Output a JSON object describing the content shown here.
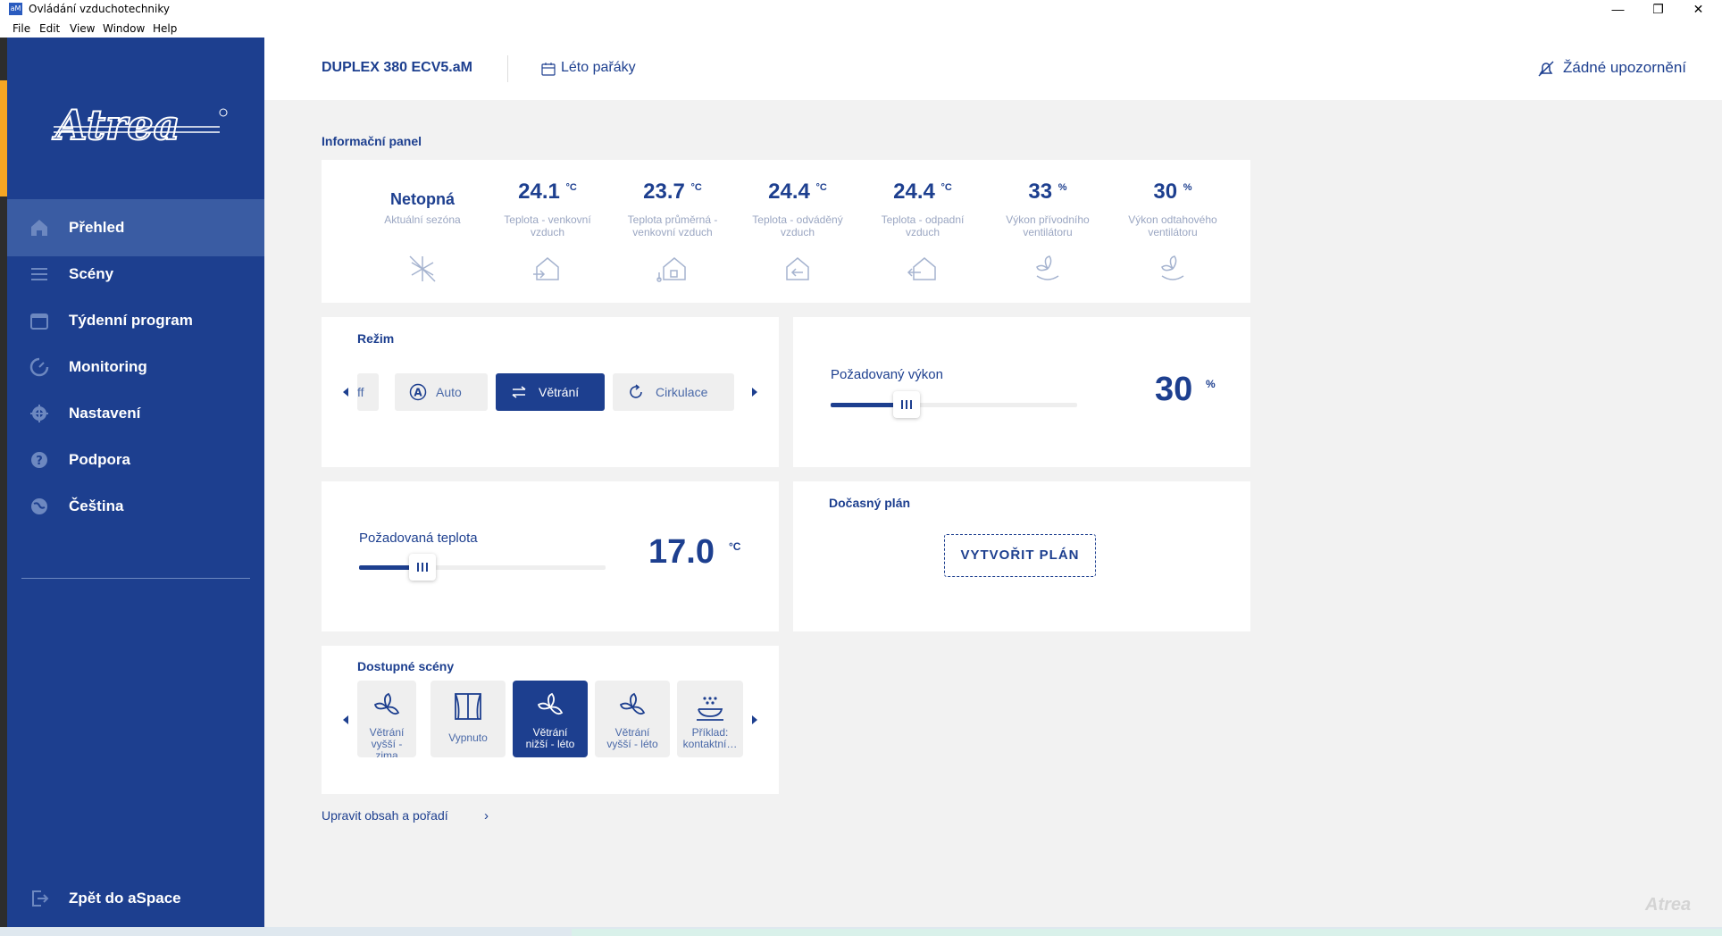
{
  "window": {
    "title": "Ovládání vzduchotechniky",
    "icon_text": "aM",
    "controls": {
      "minimize": "—",
      "maximize": "❐",
      "close": "✕"
    },
    "menu": [
      "File",
      "Edit",
      "View",
      "Window",
      "Help"
    ]
  },
  "sidebar": {
    "logo_text": "Atrea",
    "items": [
      {
        "label": "Přehled",
        "icon": "home-icon",
        "active": true
      },
      {
        "label": "Scény",
        "icon": "list-icon"
      },
      {
        "label": "Týdenní program",
        "icon": "calendar-icon"
      },
      {
        "label": "Monitoring",
        "icon": "gauge-icon"
      },
      {
        "label": "Nastavení",
        "icon": "gear-icon"
      },
      {
        "label": "Podpora",
        "icon": "help-icon"
      },
      {
        "label": "Čeština",
        "icon": "globe-icon"
      }
    ],
    "back_label": "Zpět do aSpace"
  },
  "topbar": {
    "device": "DUPLEX 380 ECV5.aM",
    "season": "Léto pařáky",
    "notifications": "Žádné upozornění"
  },
  "info_panel": {
    "title": "Informační panel",
    "metrics": [
      {
        "value": "Netopná",
        "unit": "",
        "label_line1": "Aktuální sezóna",
        "label_line2": "",
        "icon": "season-off-icon"
      },
      {
        "value": "24.1",
        "unit": "°C",
        "label_line1": "Teplota - venkovní",
        "label_line2": "vzduch",
        "icon": "house-outdoor-icon"
      },
      {
        "value": "23.7",
        "unit": "°C",
        "label_line1": "Teplota průměrná -",
        "label_line2": "venkovní vzduch",
        "icon": "house-average-icon"
      },
      {
        "value": "24.4",
        "unit": "°C",
        "label_line1": "Teplota - odváděný",
        "label_line2": "vzduch",
        "icon": "house-extract-icon"
      },
      {
        "value": "24.4",
        "unit": "°C",
        "label_line1": "Teplota - odpadní",
        "label_line2": "vzduch",
        "icon": "house-exhaust-icon"
      },
      {
        "value": "33",
        "unit": "%",
        "label_line1": "Výkon přívodního",
        "label_line2": "ventilátoru",
        "icon": "supply-fan-icon"
      },
      {
        "value": "30",
        "unit": "%",
        "label_line1": "Výkon odtahového",
        "label_line2": "ventilátoru",
        "icon": "extract-fan-icon"
      }
    ]
  },
  "mode": {
    "title": "Režim",
    "partial": "ff",
    "buttons": [
      {
        "label": "Auto",
        "icon": "auto-icon"
      },
      {
        "label": "Větrání",
        "icon": "ventilation-icon",
        "active": true
      },
      {
        "label": "Cirkulace",
        "icon": "circulation-icon"
      }
    ]
  },
  "power": {
    "title": "Požadovaný výkon",
    "value": "30",
    "unit": "%",
    "level": 0.3
  },
  "temperature": {
    "title": "Požadovaná teplota",
    "value": "17.0",
    "unit": "°C",
    "level": 0.27
  },
  "temp_plan": {
    "title": "Dočasný plán",
    "button": "VYTVOŘIT PLÁN"
  },
  "scenes": {
    "title": "Dostupné scény",
    "items": [
      {
        "line1": "Větrání",
        "line2": "vyšší - zima",
        "icon": "fan-icon"
      },
      {
        "line1": "Vypnuto",
        "line2": "",
        "icon": "curtains-icon"
      },
      {
        "line1": "Větrání",
        "line2": "nižší - léto",
        "icon": "fan-icon",
        "active": true
      },
      {
        "line1": "Větrání",
        "line2": "vyšší - léto",
        "icon": "fan-icon"
      },
      {
        "line1": "Příklad:",
        "line2": "kontaktní…",
        "icon": "cooking-icon"
      }
    ]
  },
  "edit_link": "Upravit obsah a pořadí",
  "watermark": "Atrea",
  "colors": {
    "primary": "#1d3f8f",
    "active_nav": "#3a5ca3",
    "accent": "#f5a623"
  }
}
